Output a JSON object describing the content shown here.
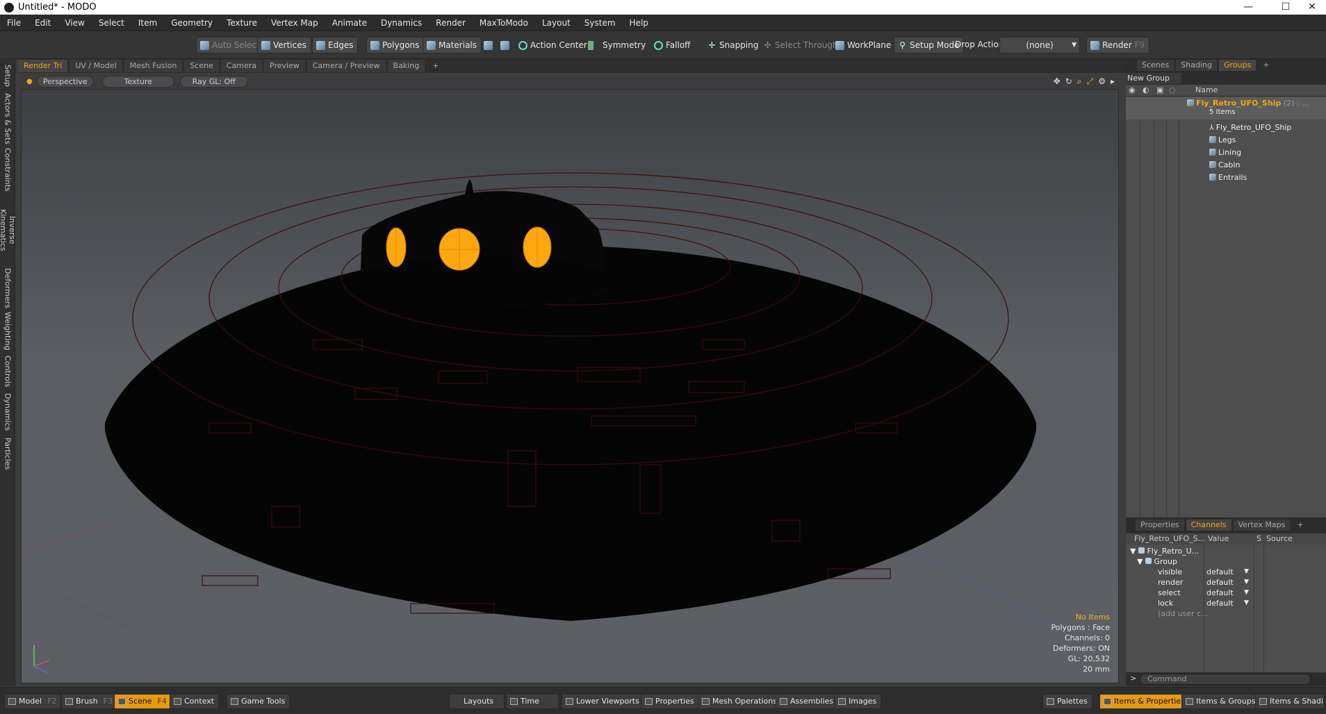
{
  "window": {
    "title": "Untitled* - MODO",
    "minimize": "—",
    "maximize": "☐",
    "close": "✕"
  },
  "menubar": [
    "File",
    "Edit",
    "View",
    "Select",
    "Item",
    "Geometry",
    "Texture",
    "Vertex Map",
    "Animate",
    "Dynamics",
    "Render",
    "MaxToModo",
    "Layout",
    "System",
    "Help"
  ],
  "toolbar": {
    "auto_select": "Auto Select",
    "vertices": "Vertices",
    "edges": "Edges",
    "polygons": "Polygons",
    "materials": "Materials",
    "action_center": "Action Center",
    "symmetry": "Symmetry",
    "falloff": "Falloff",
    "snapping": "Snapping",
    "select_through": "Select Through",
    "workplane": "WorkPlane",
    "setup_mode": "Setup Mode",
    "drop_action": "Drop Action",
    "drop_action_value": "(none)",
    "render": "Render",
    "render_key": "F9"
  },
  "left_tabs": [
    "Setup",
    "Actors & Sets",
    "Constraints",
    "Inverse Kinematics",
    "Deformers",
    "Weighting",
    "Controls",
    "Dynamics",
    "Particles"
  ],
  "viewport_tabs": [
    "Render Tri",
    "UV / Model",
    "Mesh Fusion",
    "Scene",
    "Camera",
    "Preview",
    "Camera / Preview",
    "Baking",
    "+"
  ],
  "viewport_header": {
    "view": "Perspective",
    "shading": "Texture",
    "raygl": "Ray GL: Off"
  },
  "stats": {
    "items": "No Items",
    "polygons": "Polygons : Face",
    "channels": "Channels: 0",
    "deformers": "Deformers: ON",
    "gl": "GL: 20,532",
    "scale": "20 mm"
  },
  "right_panel": {
    "tabs": [
      "Scenes",
      "Shading",
      "Groups",
      "+"
    ],
    "new_group": "New Group",
    "col_name": "Name",
    "group_name": "Fly_Retro_UFO_Ship",
    "group_count": "(2) : ...",
    "group_items": "5 Items",
    "children": [
      "Fly_Retro_UFO_Ship",
      "Legs",
      "Lining",
      "Cabin",
      "Entrails"
    ]
  },
  "channels": {
    "tabs": [
      "Properties",
      "Channels",
      "Vertex Maps",
      "+"
    ],
    "col_item": "Fly_Retro_UFO_S...",
    "col_value": "Value",
    "col_s": "S",
    "col_source": "Source",
    "root": "Fly_Retro_U...",
    "group": "Group",
    "rows": [
      {
        "name": "visible",
        "value": "default"
      },
      {
        "name": "render",
        "value": "default"
      },
      {
        "name": "select",
        "value": "default"
      },
      {
        "name": "lock",
        "value": "default"
      }
    ],
    "add_user": "(add user c..."
  },
  "command_placeholder": "Command",
  "bottom": {
    "model": "Model",
    "model_key": "F2",
    "brush": "Brush",
    "brush_key": "F3",
    "scene": "Scene",
    "scene_key": "F4",
    "context": "Context",
    "game_tools": "Game Tools",
    "layouts": "Layouts",
    "time": "Time",
    "lower_viewports": "Lower Viewports",
    "properties": "Properties",
    "mesh_operations": "Mesh Operations",
    "assemblies": "Assemblies",
    "images": "Images",
    "palettes": "Palettes",
    "items_properties": "Items & Properties",
    "items_groups": "Items & Groups",
    "items_shading": "Items & Shading"
  },
  "colors": {
    "accent": "#f3a516",
    "window_glow": "#ffa70f"
  }
}
